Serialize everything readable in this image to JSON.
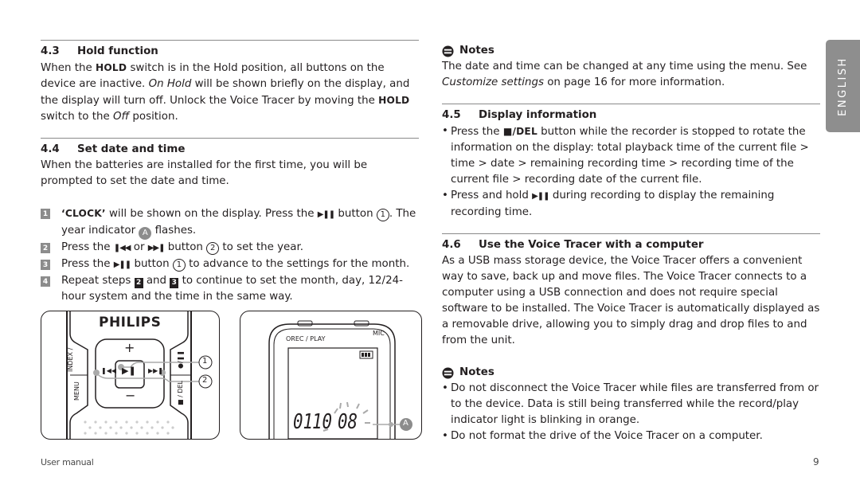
{
  "language_tab": "ENGLISH",
  "footer": {
    "left": "User manual",
    "page_number": "9"
  },
  "sections": {
    "hold": {
      "number": "4.3",
      "title": "Hold function",
      "p1_a": "When the ",
      "p1_b": "HOLD",
      "p1_c": " switch is in the Hold position, all buttons on the device are inactive. ",
      "p1_d": "On Hold",
      "p1_e": " will be shown briefly on the display, and the display will turn off. Unlock the Voice Tracer by moving the ",
      "p1_f": "HOLD",
      "p1_g": " switch to the ",
      "p1_h": "Off",
      "p1_i": " position."
    },
    "datetime": {
      "number": "4.4",
      "title": "Set date and time",
      "intro": "When the batteries are installed for the first time, you will be prompted to set the date and time.",
      "steps": [
        {
          "badge": "1",
          "a": "‘CLOCK’",
          "b": " will be shown on the display. Press the ",
          "glyph": "▶❚❚",
          "c": " button ",
          "circ": "1",
          "d": ". The year indicator ",
          "circ_a": "A",
          "e": " flashes."
        },
        {
          "badge": "2",
          "a": "Press the ",
          "glyph1": "❚◀◀",
          "b": " or ",
          "glyph2": "▶▶❚",
          "c": " button ",
          "circ": "2",
          "d": " to set the year."
        },
        {
          "badge": "3",
          "a": "Press the ",
          "glyph": "▶❚❚",
          "b": " button ",
          "circ": "1",
          "c": " to advance to the settings for the month."
        },
        {
          "badge": "4",
          "a": "Repeat steps ",
          "ref1": "2",
          "b": " and ",
          "ref2": "3",
          "c": " to continue to set the month, day, 12/24-hour system and the time in the same way."
        }
      ]
    },
    "notes1": {
      "title": "Notes",
      "text_a": "The date and time can be changed at any time using the menu. See ",
      "text_b": "Customize settings",
      "text_c": " on page 16 for more information."
    },
    "display": {
      "number": "4.5",
      "title": "Display information",
      "bullets": [
        {
          "a": "Press the ",
          "b": "■/DEL",
          "c": " button while the recorder is stopped to rotate the information on the display: total playback time of the current file > time > date > remaining recording time > recording time of the current file > recording date of the current file."
        },
        {
          "a": "Press and hold ",
          "b": "▶❚❚",
          "c": " during recording to display the remaining recording time."
        }
      ]
    },
    "computer": {
      "number": "4.6",
      "title": "Use the Voice Tracer with a computer",
      "text": "As a USB mass storage device, the Voice Tracer offers a convenient way to save, back up and move files. The Voice Tracer connects to a computer using a USB connection and does not require special software to be installed. The Voice Tracer is automatically displayed as a removable drive, allowing you to simply drag and drop files to and from the unit."
    },
    "notes2": {
      "title": "Notes",
      "bullets": [
        "Do not disconnect the Voice Tracer while files are transferred from or to the device. Data is still being transferred while the record/play indicator light is blinking in orange.",
        "Do not format the drive of the Voice Tracer on a computer."
      ]
    }
  },
  "figures": {
    "buttons": {
      "brand": "PHILIPS",
      "plus": "+",
      "minus": "−",
      "left_label": "INDEX / ",
      "left_label2": "MENU",
      "right_label": "●/❚❚",
      "right_label2": "■ / DEL",
      "callout1": "1",
      "callout2": "2"
    },
    "display": {
      "rec_label": "OREC / PLAY",
      "mic_label": "MIC",
      "digits_left": "01",
      "digits_mid": "10",
      "digits_right": "08",
      "callout": "A"
    }
  }
}
